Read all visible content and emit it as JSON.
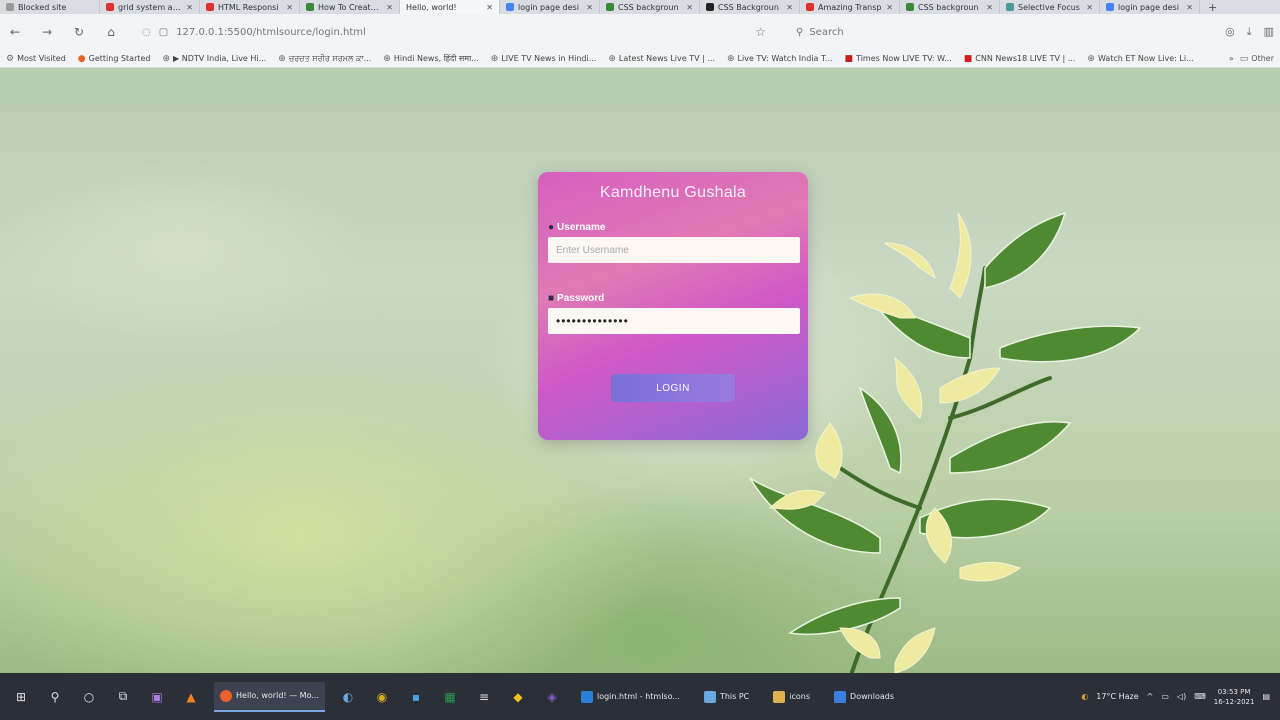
{
  "browser": {
    "tabs": [
      {
        "label": "Blocked site",
        "color": "#999999"
      },
      {
        "label": "grid system and",
        "color": "#e03030"
      },
      {
        "label": "HTML Responsi",
        "color": "#e03030"
      },
      {
        "label": "How To Create a",
        "color": "#3a8a3a"
      },
      {
        "label": "Hello, world!",
        "color": "#ffffff"
      },
      {
        "label": "login page desi",
        "color": "#4285f4"
      },
      {
        "label": "CSS backgroun",
        "color": "#3a8a3a"
      },
      {
        "label": "CSS Backgroun",
        "color": "#222222"
      },
      {
        "label": "Amazing Transp",
        "color": "#e03030"
      },
      {
        "label": "CSS backgroun",
        "color": "#3a8a3a"
      },
      {
        "label": "Selective Focus",
        "color": "#4a9a9a"
      },
      {
        "label": "login page desi",
        "color": "#4285f4"
      }
    ],
    "active_tab_index": 4,
    "url": "127.0.0.1:5500/htmlsource/login.html",
    "search_placeholder": "Search",
    "bookmarks": [
      {
        "label": "Most Visited",
        "icon": "gear"
      },
      {
        "label": "Getting Started",
        "icon": "firefox"
      },
      {
        "label": "▶ NDTV India, Live Hi...",
        "icon": "globe"
      },
      {
        "label": "ਚਰਚਤ ਸਰੀਰ ਸਰਮਲ ਕਾ...",
        "icon": "globe"
      },
      {
        "label": "Hindi News, हिंदी समा...",
        "icon": "globe"
      },
      {
        "label": "LIVE TV News in Hindi...",
        "icon": "globe"
      },
      {
        "label": "Latest News Live TV | ...",
        "icon": "globe"
      },
      {
        "label": "Live TV: Watch India T...",
        "icon": "globe"
      },
      {
        "label": "Times Now LIVE TV: W...",
        "icon": "tn"
      },
      {
        "label": "CNN News18 LIVE TV | ...",
        "icon": "news18"
      },
      {
        "label": "Watch ET Now Live: Li...",
        "icon": "globe"
      }
    ],
    "other_bookmarks": "Other"
  },
  "login": {
    "title": "Kamdhenu Gushala",
    "username_label": "Username",
    "username_placeholder": "Enter Username",
    "password_label": "Password",
    "password_value": "••••••••••••••",
    "login_button": "LOGIN"
  },
  "taskbar": {
    "apps": [
      {
        "label": "Hello, world! — Mo...",
        "color": "#e8622a",
        "active": true
      },
      {
        "label": "login.html - htmlso...",
        "color": "#2b7fd6",
        "active": false
      },
      {
        "label": "This PC",
        "color": "#6aa9e0",
        "active": false
      },
      {
        "label": "icons",
        "color": "#e0b050",
        "active": false
      },
      {
        "label": "Downloads",
        "color": "#3a7fe0",
        "active": false
      }
    ],
    "weather": "17°C  Haze",
    "time": "03:53 PM",
    "date": "16-12-2021"
  }
}
